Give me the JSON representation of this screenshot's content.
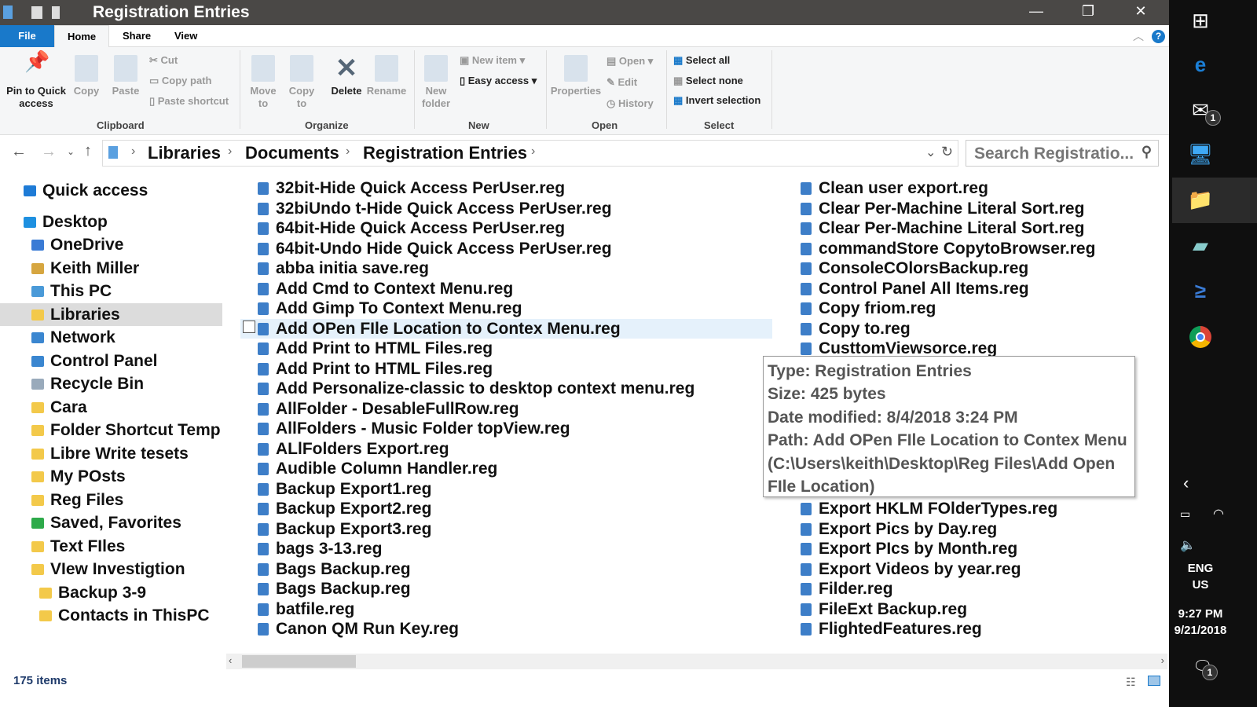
{
  "window": {
    "title": "Registration Entries",
    "minimize": "—",
    "restore": "❐",
    "close": "✕"
  },
  "tabs": [
    "File",
    "Home",
    "Share",
    "View"
  ],
  "ribbon": {
    "clipboard": {
      "pin": "Pin to Quick access",
      "copy": "Copy",
      "paste": "Paste",
      "cut": "Cut",
      "copy_path": "Copy path",
      "paste_shortcut": "Paste shortcut",
      "label": "Clipboard"
    },
    "organize": {
      "move_to": "Move to",
      "copy_to": "Copy to",
      "delete": "Delete",
      "rename": "Rename",
      "label": "Organize"
    },
    "new": {
      "new_folder": "New folder",
      "new_item": "New item",
      "easy_access": "Easy access",
      "label": "New"
    },
    "open": {
      "properties": "Properties",
      "open": "Open",
      "edit": "Edit",
      "history": "History",
      "label": "Open"
    },
    "select": {
      "select_all": "Select all",
      "select_none": "Select none",
      "invert": "Invert selection",
      "label": "Select"
    }
  },
  "address": {
    "crumbs": [
      "Libraries",
      "Documents",
      "Registration Entries"
    ],
    "search_placeholder": "Search Registratio..."
  },
  "sidebar": [
    {
      "label": "Quick access",
      "color": "#1e7bd6",
      "indent": 1
    },
    {
      "label": "Desktop",
      "color": "#1e90e0",
      "indent": 1
    },
    {
      "label": "OneDrive",
      "color": "#3a7bd5",
      "indent": 2
    },
    {
      "label": "Keith Miller",
      "color": "#d6a640",
      "indent": 2
    },
    {
      "label": "This PC",
      "color": "#4a9ad8",
      "indent": 2
    },
    {
      "label": "Libraries",
      "color": "#f3c94a",
      "indent": 2,
      "selected": true
    },
    {
      "label": "Network",
      "color": "#3a86d0",
      "indent": 2
    },
    {
      "label": "Control Panel",
      "color": "#3a86d0",
      "indent": 2
    },
    {
      "label": "Recycle Bin",
      "color": "#9ab",
      "indent": 2
    },
    {
      "label": "Cara",
      "color": "#f3c94a",
      "indent": 2
    },
    {
      "label": "Folder Shortcut Temp",
      "color": "#f3c94a",
      "indent": 2
    },
    {
      "label": "Libre Write tesets",
      "color": "#f3c94a",
      "indent": 2
    },
    {
      "label": "My POsts",
      "color": "#f3c94a",
      "indent": 2
    },
    {
      "label": "Reg Files",
      "color": "#f3c94a",
      "indent": 2
    },
    {
      "label": "Saved, Favorites",
      "color": "#2eaa4a",
      "indent": 2
    },
    {
      "label": "Text FIles",
      "color": "#f3c94a",
      "indent": 2
    },
    {
      "label": "VIew Investigtion",
      "color": "#f3c94a",
      "indent": 2
    },
    {
      "label": "Backup 3-9",
      "color": "#f3c94a",
      "indent": 3
    },
    {
      "label": "Contacts in ThisPC",
      "color": "#f3c94a",
      "indent": 3
    }
  ],
  "files_left": [
    "32bit-Hide Quick Access PerUser.reg",
    "32biUndo t-Hide Quick Access PerUser.reg",
    "64bit-Hide Quick Access PerUser.reg",
    "64bit-Undo Hide Quick Access PerUser.reg",
    "abba initia save.reg",
    "Add Cmd to Context Menu.reg",
    "Add Gimp To Context Menu.reg",
    "Add OPen FIle Location to Contex Menu.reg",
    "Add Print to HTML Files.reg",
    "Add Print to HTML Files.reg",
    "Add  Personalize-classic  to  desktop  context  menu.reg",
    "AllFolder - DesableFullRow.reg",
    "AllFolders - Music Folder topView.reg",
    "ALlFolders Export.reg",
    "Audible Column Handler.reg",
    "Backup Export1.reg",
    "Backup Export2.reg",
    "Backup Export3.reg",
    "bags 3-13.reg",
    "Bags Backup.reg",
    "Bags Backup.reg",
    "batfile.reg",
    "Canon QM Run Key.reg"
  ],
  "files_right_top": [
    "Clean user export.reg",
    "Clear Per-Machine Literal Sort.reg",
    "Clear Per-Machine Literal Sort.reg",
    "commandStore CopytoBrowser.reg",
    "ConsoleCOlorsBackup.reg",
    "Control Panel All Items.reg",
    "Copy friom.reg",
    "Copy to.reg",
    "CusttomViewsorce.reg"
  ],
  "files_right_bottom": [
    "Export HKLM FOlderTypes.reg",
    "Export Pics by Day.reg",
    "Export PIcs by Month.reg",
    "Export Videos by year.reg",
    "Filder.reg",
    "FileExt Backup.reg",
    "FlightedFeatures.reg"
  ],
  "tooltip": [
    "Type: Registration Entries",
    "Size: 425 bytes",
    "Date modified: 8/4/2018 3:24 PM",
    "Path: Add OPen FIle Location to Contex Menu",
    "(C:\\Users\\keith\\Desktop\\Reg Files\\Add Open",
    "FIle Location)"
  ],
  "status": {
    "items": "175 items"
  },
  "taskbar": {
    "mail_badge": "1",
    "lang1": "ENG",
    "lang2": "US",
    "time": "9:27 PM",
    "date": "9/21/2018",
    "notif_badge": "1"
  },
  "colors": {
    "accent": "#1979ca",
    "titlebar": "#4a4846",
    "taskbar": "#0f0f0f",
    "hover": "#e5f1fb"
  }
}
